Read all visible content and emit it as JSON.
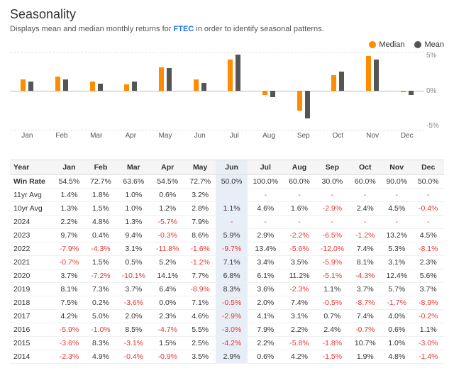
{
  "title": "Seasonality",
  "subtitle_pre": "Displays mean and median monthly returns for ",
  "subtitle_ticker": "FTEC",
  "subtitle_post": " in order to identify seasonal patterns.",
  "legend": {
    "median_label": "Median",
    "mean_label": "Mean",
    "median_color": "#ff8c00",
    "mean_color": "#555555"
  },
  "months": [
    "Jan",
    "Feb",
    "Mar",
    "Apr",
    "May",
    "Jun",
    "Jul",
    "Aug",
    "Sep",
    "Oct",
    "Nov",
    "Dec"
  ],
  "chart": {
    "y_labels": [
      "5%",
      "0%",
      "-5%"
    ],
    "bars": [
      {
        "month": "Jan",
        "median": 1.5,
        "mean": 1.2
      },
      {
        "month": "Feb",
        "median": 1.8,
        "mean": 1.5
      },
      {
        "month": "Mar",
        "median": 1.2,
        "mean": 0.9
      },
      {
        "month": "Apr",
        "median": 0.8,
        "mean": 1.2
      },
      {
        "month": "May",
        "median": 3.0,
        "mean": 2.9
      },
      {
        "month": "Jun",
        "median": 1.5,
        "mean": 1.0
      },
      {
        "month": "Jul",
        "median": 4.0,
        "mean": 4.6
      },
      {
        "month": "Aug",
        "median": -0.5,
        "mean": -0.8
      },
      {
        "month": "Sep",
        "median": -2.5,
        "mean": -3.5
      },
      {
        "month": "Oct",
        "median": 2.0,
        "mean": 2.5
      },
      {
        "month": "Nov",
        "median": 4.5,
        "mean": 4.0
      },
      {
        "month": "Dec",
        "median": -0.2,
        "mean": -0.5
      }
    ]
  },
  "table": {
    "headers": [
      "Year",
      "Jan",
      "Feb",
      "Mar",
      "Apr",
      "May",
      "Jun",
      "Jul",
      "Aug",
      "Sep",
      "Oct",
      "Nov",
      "Dec"
    ],
    "rows": [
      {
        "year": "Win Rate",
        "values": [
          "54.5%",
          "72.7%",
          "63.6%",
          "54.5%",
          "72.7%",
          "50.0%",
          "100.0%",
          "60.0%",
          "30.0%",
          "60.0%",
          "90.0%",
          "50.0%"
        ],
        "types": [
          "p",
          "p",
          "p",
          "p",
          "p",
          "p",
          "p",
          "p",
          "p",
          "p",
          "p",
          "p"
        ]
      },
      {
        "year": "11yr Avg",
        "values": [
          "1.4%",
          "1.8%",
          "1.0%",
          "0.6%",
          "3.2%",
          "",
          "-",
          "-",
          "-",
          "-",
          "-",
          "-"
        ],
        "types": [
          "p",
          "p",
          "p",
          "p",
          "p",
          "n",
          "n",
          "n",
          "n",
          "n",
          "n",
          "n"
        ]
      },
      {
        "year": "10yr Avg",
        "values": [
          "1.3%",
          "1.5%",
          "1.0%",
          "1.2%",
          "2.8%",
          "1.1%",
          "4.6%",
          "1.6%",
          "-2.9%",
          "2.4%",
          "4.5%",
          "-0.4%"
        ],
        "types": [
          "p",
          "p",
          "p",
          "p",
          "p",
          "p",
          "p",
          "p",
          "n",
          "p",
          "p",
          "n"
        ]
      },
      {
        "year": "2024",
        "values": [
          "2.2%",
          "4.8%",
          "1.3%",
          "-5.7%",
          "7.9%",
          "-",
          "-",
          "-",
          "-",
          "-",
          "-",
          "-"
        ],
        "types": [
          "p",
          "p",
          "p",
          "n",
          "p",
          "n",
          "n",
          "n",
          "n",
          "n",
          "n",
          "n"
        ]
      },
      {
        "year": "2023",
        "values": [
          "9.7%",
          "0.4%",
          "9.4%",
          "-0.3%",
          "8.6%",
          "5.9%",
          "2.9%",
          "-2.2%",
          "-6.5%",
          "-1.2%",
          "13.2%",
          "4.5%"
        ],
        "types": [
          "p",
          "p",
          "p",
          "n",
          "p",
          "p",
          "p",
          "n",
          "n",
          "n",
          "p",
          "p"
        ]
      },
      {
        "year": "2022",
        "values": [
          "-7.9%",
          "-4.3%",
          "3.1%",
          "-11.8%",
          "-1.6%",
          "-9.7%",
          "13.4%",
          "-5.6%",
          "-12.0%",
          "7.4%",
          "5.3%",
          "-8.1%"
        ],
        "types": [
          "n",
          "n",
          "p",
          "n",
          "n",
          "n",
          "p",
          "n",
          "n",
          "p",
          "p",
          "n"
        ]
      },
      {
        "year": "2021",
        "values": [
          "-0.7%",
          "1.5%",
          "0.5%",
          "5.2%",
          "-1.2%",
          "7.1%",
          "3.4%",
          "3.5%",
          "-5.9%",
          "8.1%",
          "3.1%",
          "2.3%"
        ],
        "types": [
          "n",
          "p",
          "p",
          "p",
          "n",
          "p",
          "p",
          "p",
          "n",
          "p",
          "p",
          "p"
        ]
      },
      {
        "year": "2020",
        "values": [
          "3.7%",
          "-7.2%",
          "-10.1%",
          "14.1%",
          "7.7%",
          "6.8%",
          "6.1%",
          "11.2%",
          "-5.1%",
          "-4.3%",
          "12.4%",
          "5.6%"
        ],
        "types": [
          "p",
          "n",
          "n",
          "p",
          "p",
          "p",
          "p",
          "p",
          "n",
          "n",
          "p",
          "p"
        ]
      },
      {
        "year": "2019",
        "values": [
          "8.1%",
          "7.3%",
          "3.7%",
          "6.4%",
          "-8.9%",
          "8.3%",
          "3.6%",
          "-2.3%",
          "1.1%",
          "3.7%",
          "5.7%",
          "3.7%"
        ],
        "types": [
          "p",
          "p",
          "p",
          "p",
          "n",
          "p",
          "p",
          "n",
          "p",
          "p",
          "p",
          "p"
        ]
      },
      {
        "year": "2018",
        "values": [
          "7.5%",
          "0.2%",
          "-3.6%",
          "0.0%",
          "7.1%",
          "-0.5%",
          "2.0%",
          "7.4%",
          "-0.5%",
          "-8.7%",
          "-1.7%",
          "-8.9%"
        ],
        "types": [
          "p",
          "p",
          "n",
          "p",
          "p",
          "n",
          "p",
          "p",
          "n",
          "n",
          "n",
          "n"
        ]
      },
      {
        "year": "2017",
        "values": [
          "4.2%",
          "5.0%",
          "2.0%",
          "2.3%",
          "4.6%",
          "-2.9%",
          "4.1%",
          "3.1%",
          "0.7%",
          "7.4%",
          "4.0%",
          "-0.2%"
        ],
        "types": [
          "p",
          "p",
          "p",
          "p",
          "p",
          "n",
          "p",
          "p",
          "p",
          "p",
          "p",
          "n"
        ]
      },
      {
        "year": "2016",
        "values": [
          "-5.9%",
          "-1.0%",
          "8.5%",
          "-4.7%",
          "5.5%",
          "-3.0%",
          "7.9%",
          "2.2%",
          "2.4%",
          "-0.7%",
          "0.6%",
          "1.1%"
        ],
        "types": [
          "n",
          "n",
          "p",
          "n",
          "p",
          "n",
          "p",
          "p",
          "p",
          "n",
          "p",
          "p"
        ]
      },
      {
        "year": "2015",
        "values": [
          "-3.6%",
          "8.3%",
          "-3.1%",
          "1.5%",
          "2.5%",
          "-4.2%",
          "2.2%",
          "-5.8%",
          "-1.8%",
          "10.7%",
          "1.0%",
          "-3.0%"
        ],
        "types": [
          "n",
          "p",
          "n",
          "p",
          "p",
          "n",
          "p",
          "n",
          "n",
          "p",
          "p",
          "n"
        ]
      },
      {
        "year": "2014",
        "values": [
          "-2.3%",
          "4.9%",
          "-0.4%",
          "-0.9%",
          "3.5%",
          "2.9%",
          "0.6%",
          "4.2%",
          "-1.5%",
          "1.9%",
          "4.8%",
          "-1.4%"
        ],
        "types": [
          "n",
          "p",
          "n",
          "n",
          "p",
          "p",
          "p",
          "p",
          "n",
          "p",
          "p",
          "n"
        ]
      }
    ]
  }
}
